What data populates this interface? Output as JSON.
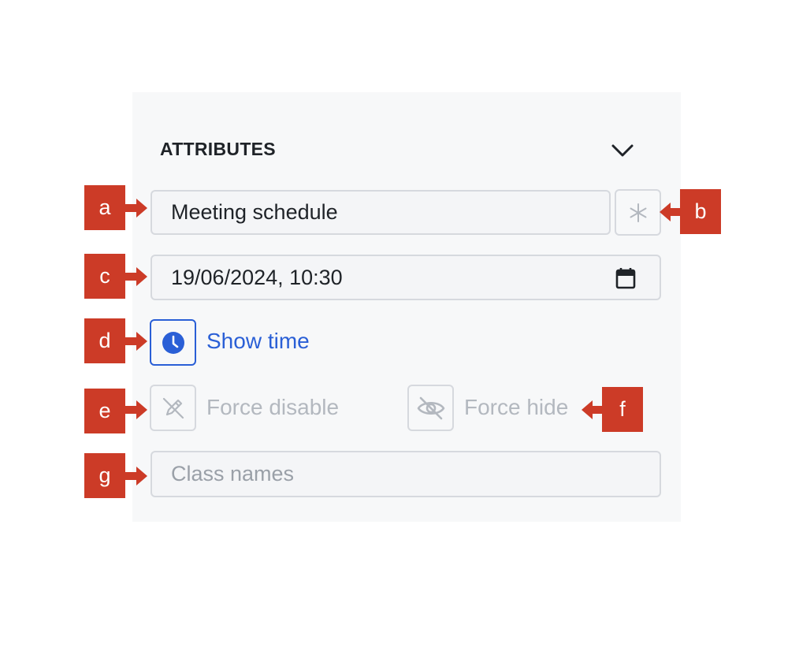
{
  "section": {
    "title": "ATTRIBUTES"
  },
  "name_field": {
    "value": "Meeting schedule"
  },
  "datetime_field": {
    "value": "19/06/2024, 10:30"
  },
  "toggles": {
    "show_time": {
      "label": "Show time",
      "active": true
    },
    "force_disable": {
      "label": "Force disable",
      "active": false
    },
    "force_hide": {
      "label": "Force hide",
      "active": false
    }
  },
  "class_field": {
    "placeholder": "Class names",
    "value": ""
  },
  "callouts": {
    "a": "a",
    "b": "b",
    "c": "c",
    "d": "d",
    "e": "e",
    "f": "f",
    "g": "g"
  },
  "colors": {
    "accent": "#2a5fd6",
    "callout": "#cc3b27",
    "muted": "#b3b8bf",
    "panel": "#f7f8f9"
  },
  "icons": {
    "collapse": "chevron-down-icon",
    "required": "asterisk-icon",
    "calendar": "calendar-icon",
    "show_time": "clock-icon",
    "force_disable": "pencil-off-icon",
    "force_hide": "eye-off-icon"
  }
}
